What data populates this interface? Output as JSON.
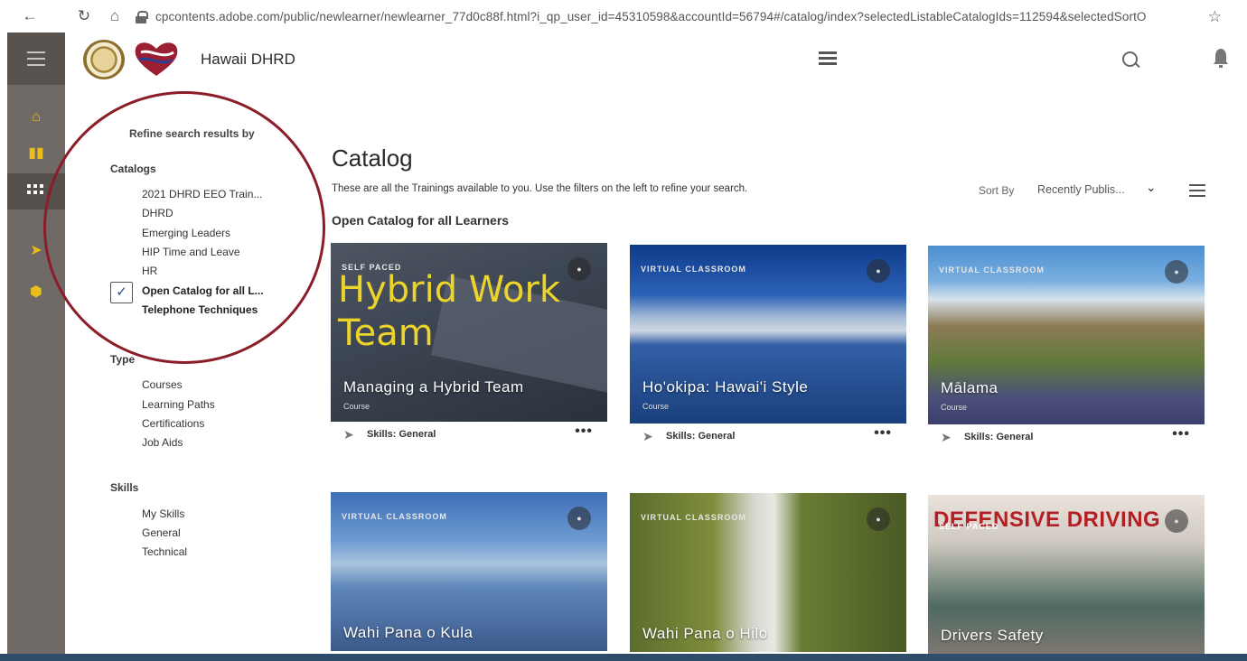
{
  "browser": {
    "url": "cpcontents.adobe.com/public/newlearner/newlearner_77d0c88f.html?i_qp_user_id=45310598&accountId=56794#/catalog/index?selectedListableCatalogIds=112594&selectedSortO"
  },
  "header": {
    "brand": "Hawaii DHRD"
  },
  "filters": {
    "title": "Refine search results by",
    "catalogs": {
      "heading": "Catalogs",
      "items": [
        "2021 DHRD EEO Train...",
        "DHRD",
        "Emerging Leaders",
        "HIP Time and Leave",
        "HR",
        "Open Catalog for all L...",
        "Telephone Techniques"
      ],
      "checked_check": "✓"
    },
    "type": {
      "heading": "Type",
      "items": [
        "Courses",
        "Learning Paths",
        "Certifications",
        "Job Aids"
      ]
    },
    "skills": {
      "heading": "Skills",
      "items": [
        "My Skills",
        "General",
        "Technical"
      ]
    }
  },
  "catalog": {
    "title": "Catalog",
    "description": "These are all the Trainings available to you. Use the filters on the left to refine your search.",
    "section": "Open Catalog for all Learners",
    "sort_label": "Sort By",
    "sort_value": "Recently Publis...",
    "cards": [
      {
        "name": "Managing a Hybrid Team",
        "type": "SELF PACED",
        "sub": "Course",
        "skills": "Skills: General",
        "image_text": [
          "Hybrid Work",
          "Team"
        ]
      },
      {
        "name": "Ho'okipa: Hawai'i Style",
        "type": "VIRTUAL CLASSROOM",
        "sub": "Course",
        "skills": "Skills: General"
      },
      {
        "name": "Mālama",
        "type": "VIRTUAL CLASSROOM",
        "sub": "Course",
        "skills": "Skills: General"
      },
      {
        "name": "Wahi Pana o Kula",
        "type": "VIRTUAL CLASSROOM"
      },
      {
        "name": "Wahi Pana o Hilo",
        "type": "VIRTUAL CLASSROOM"
      },
      {
        "name": "Drivers Safety",
        "type": "SELF PACED",
        "image_text": [
          "DEFENSIVE DRIVING"
        ]
      }
    ]
  },
  "colors": {
    "rail": "#6f6a66",
    "rail_icon": "#e9bd1b",
    "annotation_circle": "#8c1d28"
  }
}
